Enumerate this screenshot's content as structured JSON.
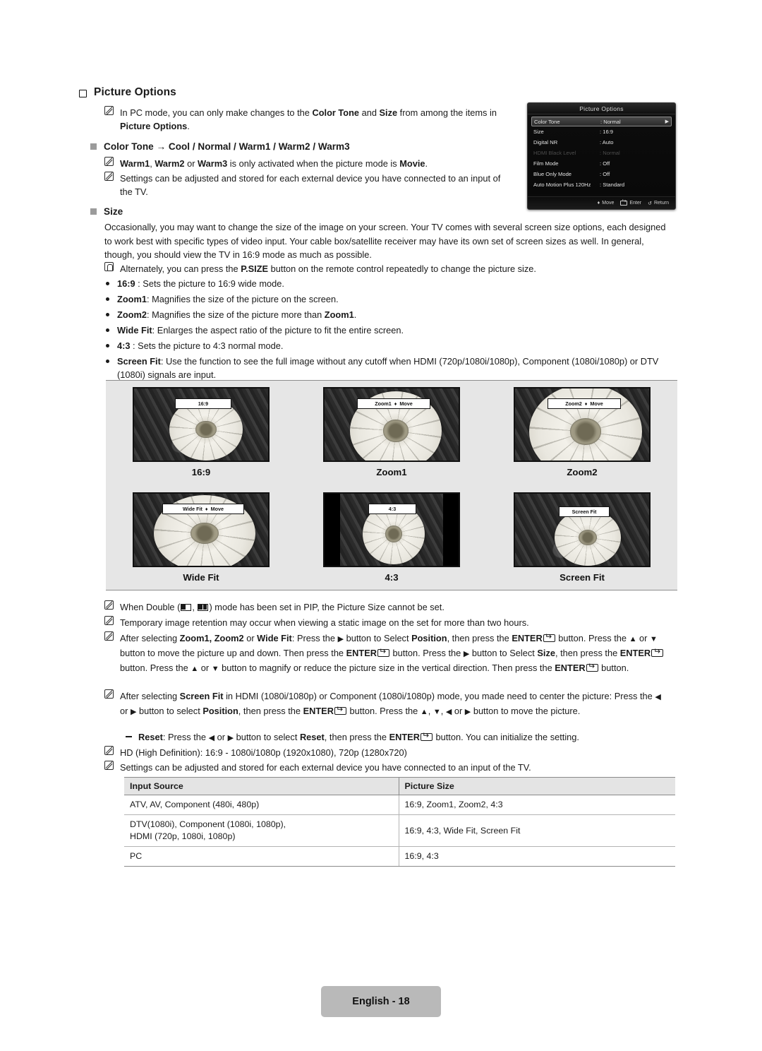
{
  "document": {
    "section_title": "Picture Options",
    "footer_label": "English - 18"
  },
  "intro_note": {
    "icon": "note-pencil-icon",
    "text_parts": [
      "In PC mode, you can only make changes to the ",
      "Color Tone",
      " and ",
      "Size",
      " from among the items in ",
      "Picture Options",
      "."
    ]
  },
  "color_tone": {
    "heading": "Color Tone → Cool / Normal / Warm1 / Warm2 / Warm3",
    "notes": [
      {
        "icon": "note-pencil-icon",
        "text": "Warm1, Warm2 or Warm3 is only activated when the picture mode is Movie."
      },
      {
        "icon": "note-pencil-icon",
        "text": "Settings can be adjusted and stored for each external device you have connected to an input of the TV."
      }
    ]
  },
  "size": {
    "heading": "Size",
    "paragraph": "Occasionally, you may want to change the size of the image on your screen. Your TV comes with several screen size options, each designed to work best with specific types of video input. Your cable box/satellite receiver may have its own set of screen sizes as well. In general, though, you should view the TV in 16:9 mode as much as possible.",
    "alt_note": "Alternately, you can press the P.SIZE button on the remote control repeatedly to change the picture size.",
    "bullets": [
      {
        "term": "16:9",
        "sep": " : ",
        "desc": "Sets the picture to 16:9 wide mode."
      },
      {
        "term": "Zoom1",
        "sep": ": ",
        "desc": "Magnifies the size of the picture on the screen."
      },
      {
        "term": "Zoom2",
        "sep": ": ",
        "desc": "Magnifies the size of the picture more than Zoom1."
      },
      {
        "term": "Wide Fit",
        "sep": ": ",
        "desc": "Enlarges the aspect ratio of the picture to fit the entire screen."
      },
      {
        "term": "4:3",
        "sep": " : ",
        "desc": "Sets the picture to 4:3 normal mode."
      },
      {
        "term": "Screen Fit",
        "sep": ": ",
        "desc": "Use the function to see the full image without any cutoff when HDMI (720p/1080i/1080p), Component (1080i/1080p) or DTV (1080i) signals are input."
      }
    ]
  },
  "osd": {
    "title": "Picture Options",
    "rows": [
      {
        "label": "Color Tone",
        "value": ": Normal",
        "selected": true,
        "dimmed": false,
        "caret": "▶"
      },
      {
        "label": "Size",
        "value": ": 16:9",
        "selected": false,
        "dimmed": false,
        "caret": ""
      },
      {
        "label": "Digital NR",
        "value": ": Auto",
        "selected": false,
        "dimmed": false,
        "caret": ""
      },
      {
        "label": "HDMI Black Level",
        "value": ": Normal",
        "selected": false,
        "dimmed": true,
        "caret": ""
      },
      {
        "label": "Film Mode",
        "value": ": Off",
        "selected": false,
        "dimmed": false,
        "caret": ""
      },
      {
        "label": "Blue Only Mode",
        "value": ": Off",
        "selected": false,
        "dimmed": false,
        "caret": ""
      },
      {
        "label": "Auto Motion Plus 120Hz",
        "value": ": Standard",
        "selected": false,
        "dimmed": false,
        "caret": ""
      }
    ],
    "footer": [
      {
        "icon": "updown-arrow-icon",
        "label": "Move"
      },
      {
        "icon": "enter-key-icon",
        "label": "Enter"
      },
      {
        "icon": "return-arrow-icon",
        "label": "Return"
      }
    ]
  },
  "gallery": {
    "items": [
      {
        "caption": "16:9",
        "osd_label": "16:9",
        "osd_move": "",
        "pillarbox": false,
        "flower_scale": "normal"
      },
      {
        "caption": "Zoom1",
        "osd_label": "Zoom1",
        "osd_move": "Move",
        "pillarbox": false,
        "flower_scale": "zoom1"
      },
      {
        "caption": "Zoom2",
        "osd_label": "Zoom2",
        "osd_move": "Move",
        "pillarbox": false,
        "flower_scale": "zoom2"
      },
      {
        "caption": "Wide Fit",
        "osd_label": "Wide Fit",
        "osd_move": "Move",
        "pillarbox": false,
        "flower_scale": "widefit"
      },
      {
        "caption": "4:3",
        "osd_label": "4:3",
        "osd_move": "",
        "pillarbox": true,
        "flower_scale": "fourthree"
      },
      {
        "caption": "Screen Fit",
        "osd_label": "Screen Fit",
        "osd_move": "",
        "pillarbox": false,
        "flower_scale": "screenfit"
      }
    ],
    "move_glyph": "♦"
  },
  "bottom_notes": {
    "n1_a": "When Double (",
    "n1_b": ", ",
    "n1_c": ") mode has been set in PIP, the Picture Size cannot be set.",
    "n2": "Temporary image retention may occur when viewing a static image on the set for more than two hours.",
    "n3_l1_a": "After selecting ",
    "n3_l1_b": "Zoom1, Zoom2",
    "n3_l1_c": " or ",
    "n3_l1_d": "Wide Fit",
    "n3_l1_e": ": Press the ",
    "n3_l1_f": " button to Select ",
    "n3_l1_g": "Position",
    "n3_l1_h": ", then press the ",
    "n3_l1_i": "ENTER",
    "n3_l1_j": " button. Press",
    "n3_l2_a": "the ",
    "n3_l2_b": " or ",
    "n3_l2_c": " button to move the picture up and down. Then press the ",
    "n3_l2_d": "ENTER",
    "n3_l2_e": " button. Press the ",
    "n3_l2_f": " button to Select ",
    "n3_l2_g": "Size",
    "n3_l2_h": ",",
    "n3_l3_a": "then press the ",
    "n3_l3_b": "ENTER",
    "n3_l3_c": " button. Press the ",
    "n3_l3_d": " or ",
    "n3_l3_e": " button to magnify or reduce the picture size in the vertical direction. Then",
    "n3_l4_a": "press the ",
    "n3_l4_b": "ENTER",
    "n3_l4_c": " button.",
    "n4_l1_a": "After selecting ",
    "n4_l1_b": "Screen Fit",
    "n4_l1_c": " in HDMI (1080i/1080p) or Component (1080i/1080p) mode, you made need to center the picture:",
    "n4_l2_a": "Press the ",
    "n4_l2_b": " or ",
    "n4_l2_c": " button to select ",
    "n4_l2_d": "Position",
    "n4_l2_e": ", then press the ",
    "n4_l2_f": "ENTER",
    "n4_l2_g": " button. Press the ",
    "n4_l2_h": ", ",
    "n4_l2_i": ", ",
    "n4_l2_j": " or ",
    "n4_l2_k": " button to move the",
    "n4_l3": "picture.",
    "n5_a": "Reset",
    "n5_b": ": Press the ",
    "n5_c": " or ",
    "n5_d": " button to select ",
    "n5_e": "Reset",
    "n5_f": ", then press the ",
    "n5_g": "ENTER",
    "n5_h": " button. You can initialize the setting.",
    "n6": "HD (High Definition): 16:9 - 1080i/1080p (1920x1080), 720p (1280x720)",
    "n7": "Settings can be adjusted and stored for each external device you have connected to an input of the TV."
  },
  "table": {
    "headers": [
      "Input Source",
      "Picture Size"
    ],
    "rows": [
      {
        "source": "ATV, AV, Component (480i, 480p)",
        "source2": "",
        "size": "16:9, Zoom1, Zoom2, 4:3"
      },
      {
        "source": "DTV(1080i), Component (1080i, 1080p),",
        "source2": "HDMI (720p, 1080i, 1080p)",
        "size": "16:9, 4:3, Wide Fit, Screen Fit"
      },
      {
        "source": "PC",
        "source2": "",
        "size": "16:9, 4:3"
      }
    ]
  },
  "glyphs": {
    "right": "▶",
    "left": "◀",
    "up": "▲",
    "down": "▼",
    "arrow_right": "→"
  },
  "colors": {
    "page_bg": "#ffffff",
    "gallery_bg": "#e6e6e6",
    "table_header_bg": "#e4e4e4",
    "footer_bg": "#b9b9b9",
    "osd_bg": "#0c0c0c",
    "text": "#1a1a1a"
  }
}
